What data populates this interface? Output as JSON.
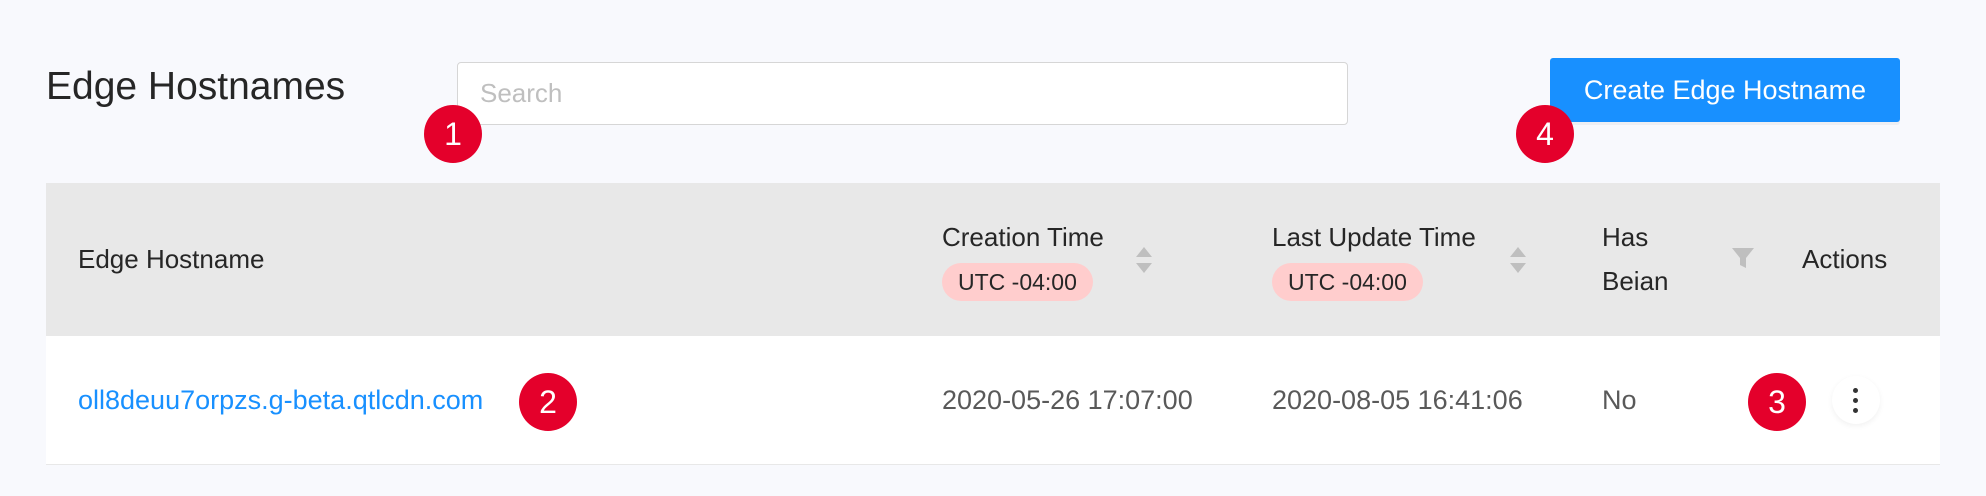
{
  "header": {
    "title": "Edge Hostnames",
    "create_button_label": "Create Edge Hostname"
  },
  "search": {
    "placeholder": "Search",
    "value": ""
  },
  "table": {
    "columns": {
      "edge_hostname": "Edge Hostname",
      "creation_time": "Creation Time",
      "creation_tz": "UTC -04:00",
      "last_update_time": "Last Update Time",
      "last_update_tz": "UTC -04:00",
      "has_beian_line1": "Has",
      "has_beian_line2": "Beian",
      "actions": "Actions"
    },
    "rows": [
      {
        "edge_hostname": "oll8deuu7orpzs.g-beta.qtlcdn.com",
        "creation_time": "2020-05-26 17:07:00",
        "last_update_time": "2020-08-05 16:41:06",
        "has_beian": "No"
      }
    ]
  },
  "markers": [
    "1",
    "2",
    "3",
    "4"
  ],
  "icons": {
    "sort": "sort-icon",
    "filter": "filter-icon",
    "actions": "more-vertical-icon"
  },
  "colors": {
    "primary": "#1890ff",
    "marker": "#e4002b",
    "timezone_badge": "#ffcdcd",
    "header_background": "#e8e8e8",
    "page_background": "#f8f9fd"
  }
}
